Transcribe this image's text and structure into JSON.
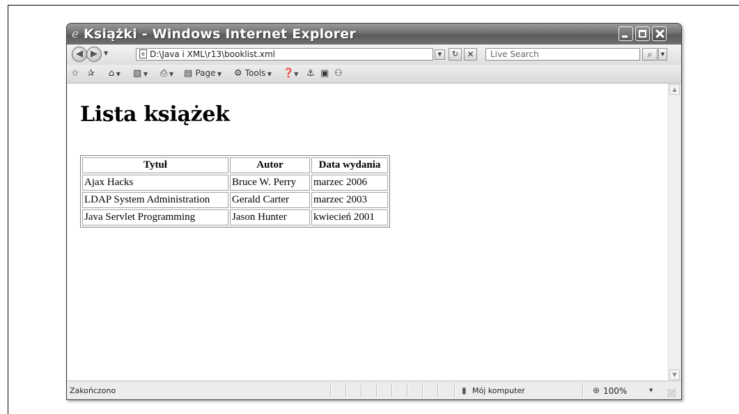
{
  "window": {
    "title": "Książki - Windows Internet Explorer"
  },
  "navbar": {
    "address": "D:\\Java i XML\\r13\\booklist.xml",
    "search_placeholder": "Live Search"
  },
  "cmdbar": {
    "page_label": "Page",
    "tools_label": "Tools"
  },
  "page": {
    "heading": "Lista książek",
    "table": {
      "headers": [
        "Tytuł",
        "Autor",
        "Data wydania"
      ],
      "rows": [
        [
          "Ajax Hacks",
          "Bruce W. Perry",
          "marzec 2006"
        ],
        [
          "LDAP System Administration",
          "Gerald Carter",
          "marzec 2003"
        ],
        [
          "Java Servlet Programming",
          "Jason Hunter",
          "kwiecień 2001"
        ]
      ]
    }
  },
  "statusbar": {
    "status": "Zakończono",
    "zone": "Mój komputer",
    "zoom": "100%"
  },
  "icons": {
    "back": "back-arrow-icon",
    "forward": "forward-arrow-icon",
    "refresh": "refresh-icon",
    "stop": "stop-icon",
    "search": "magnifier-icon",
    "favorites": "star-icon",
    "add_favorites": "add-favorites-icon",
    "home": "home-icon",
    "feeds": "feeds-icon",
    "print": "printer-icon",
    "page": "page-icon",
    "tools": "gear-icon",
    "help": "help-icon",
    "research": "research-icon",
    "messenger": "messenger-icon",
    "computer": "computer-icon",
    "zoom": "zoom-icon"
  }
}
